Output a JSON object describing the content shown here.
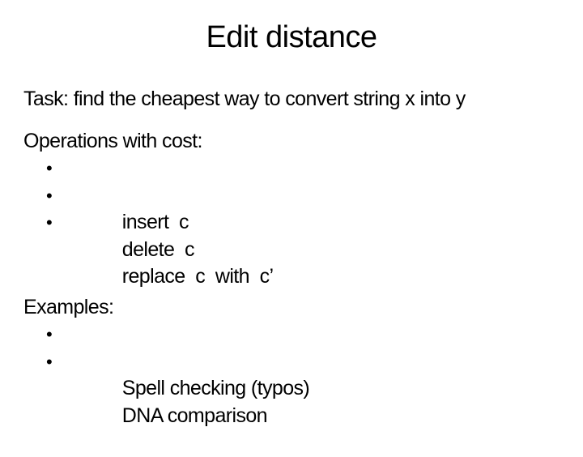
{
  "slide": {
    "title": "Edit distance",
    "task": "Task: find the cheapest way to convert string x into y",
    "operations": {
      "heading": "Operations with cost:",
      "items": [
        {
          "bullet": "•",
          "text": "insert  c"
        },
        {
          "bullet": "•",
          "text": "delete  c"
        },
        {
          "bullet": "•",
          "text": "replace  c  with  c’"
        }
      ]
    },
    "examples": {
      "heading": "Examples:",
      "items": [
        {
          "bullet": "•",
          "text": "Spell checking (typos)"
        },
        {
          "bullet": "•",
          "text": "DNA comparison"
        }
      ]
    }
  }
}
